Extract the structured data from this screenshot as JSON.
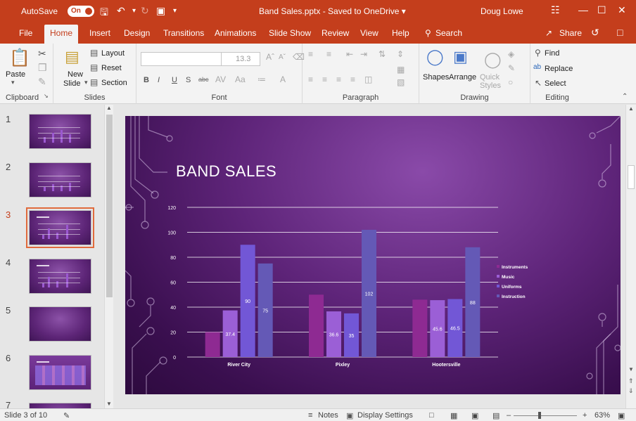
{
  "titlebar": {
    "autosave_label": "AutoSave",
    "autosave_state": "On",
    "document_title": "Band Sales.pptx - Saved to OneDrive ▾",
    "user": "Doug Lowe"
  },
  "tabs": [
    "File",
    "Home",
    "Insert",
    "Design",
    "Transitions",
    "Animations",
    "Slide Show",
    "Review",
    "View",
    "Help"
  ],
  "tell_me": "Search",
  "share_label": "Share",
  "ribbon": {
    "clipboard": {
      "paste": "Paste",
      "label": "Clipboard"
    },
    "slides": {
      "new_slide": "New",
      "new_slide2": "Slide",
      "layout": "Layout",
      "reset": "Reset",
      "section": "Section",
      "label": "Slides"
    },
    "font": {
      "size": "13.3",
      "label": "Font",
      "bold": "B",
      "italic": "I",
      "underline": "U",
      "strike": "S",
      "abc": "abc"
    },
    "paragraph": {
      "label": "Paragraph"
    },
    "drawing": {
      "shapes": "Shapes",
      "arrange": "Arrange",
      "quick": "Quick",
      "styles": "Styles",
      "label": "Drawing"
    },
    "editing": {
      "find": "Find",
      "replace": "Replace",
      "select": "Select",
      "label": "Editing"
    }
  },
  "thumbnails": [
    "1",
    "2",
    "3",
    "4",
    "5",
    "6",
    "7"
  ],
  "active_slide": "3",
  "slide": {
    "title": "BAND SALES"
  },
  "chart_data": {
    "type": "bar",
    "title": "",
    "categories": [
      "River City",
      "Pixley",
      "Hootersville"
    ],
    "series": [
      {
        "name": "Instruments",
        "values": [
          20,
          50,
          46
        ],
        "color": "#8e2a92"
      },
      {
        "name": "Music",
        "values": [
          37.4,
          36.6,
          45.6
        ],
        "color": "#9b5fd6"
      },
      {
        "name": "Uniforms",
        "values": [
          90,
          35,
          46.5
        ],
        "color": "#7257d6"
      },
      {
        "name": "Instruction",
        "values": [
          75,
          102,
          88
        ],
        "color": "#6459b6"
      }
    ],
    "data_labels": [
      [
        "",
        "",
        ""
      ],
      [
        "37.4",
        "36.6",
        "45.6"
      ],
      [
        "90",
        "35",
        "46.5"
      ],
      [
        "75",
        "102",
        "88"
      ]
    ],
    "y_ticks": [
      "0",
      "20",
      "40",
      "60",
      "80",
      "100",
      "120"
    ],
    "ylim": [
      0,
      120
    ],
    "grid": true,
    "legend": "right"
  },
  "status": {
    "slide_info": "Slide 3 of 10",
    "notes": "Notes",
    "display_settings": "Display Settings",
    "zoom": "63%"
  },
  "colors": {
    "accent": "#c43e1c",
    "ribbon_bg": "#f3f3f3"
  }
}
